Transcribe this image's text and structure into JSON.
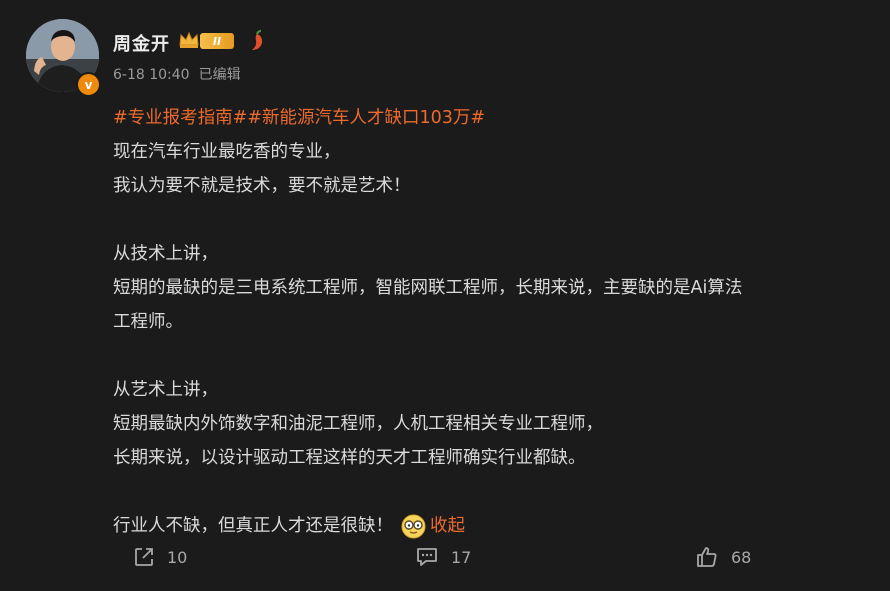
{
  "post": {
    "author": "周金开",
    "level": "II",
    "verified_mark": "v",
    "time": "6-18 10:40",
    "edited": "已编辑",
    "tags": "#专业报考指南##新能源汽车人才缺口103万#",
    "lines": {
      "l1": "现在汽车行业最吃香的专业，",
      "l2": "我认为要不就是技术，要不就是艺术！",
      "l3": "从技术上讲，",
      "l4": "短期的最缺的是三电系统工程师，智能网联工程师，长期来说，主要缺的是Ai算法",
      "l5": "工程师。",
      "l6": "从艺术上讲，",
      "l7": "短期最缺内外饰数字和油泥工程师，人机工程相关专业工程师，",
      "l8": "长期来说，以设计驱动工程这样的天才工程师确实行业都缺。",
      "l9": "行业人不缺，但真正人才还是很缺！"
    },
    "collapse_label": "收起"
  },
  "actions": {
    "repost_count": "10",
    "comment_count": "17",
    "like_count": "68"
  },
  "icons": {
    "crown": "crown-icon",
    "pepper": "pepper-icon",
    "emoji": "glasses-emoji-icon",
    "repost": "repost-icon",
    "comment": "comment-icon",
    "like": "thumbs-up-icon"
  },
  "colors": {
    "background": "#1b1b1b",
    "accent": "#ec6a2c",
    "verified": "#f08a0c",
    "text": "#dadada",
    "muted": "#9a9a9a"
  }
}
